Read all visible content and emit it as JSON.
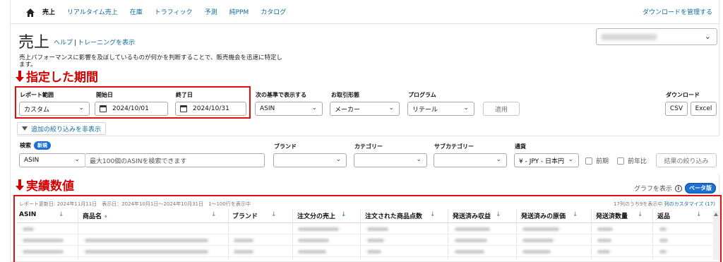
{
  "nav": {
    "items": [
      "売上",
      "リアルタイム売上",
      "在庫",
      "トラフィック",
      "予測",
      "純PPM",
      "カタログ"
    ],
    "active_index": 0,
    "download_manage": "ダウンロードを管理する"
  },
  "header": {
    "title": "売上",
    "help": "ヘルプ",
    "training": "トレーニングを表示",
    "description_line1": "売上パフォーマンスに影響を及ぼしているものが何かを判断することで、販売機会を迅速に特定し",
    "description_line2": "ます。"
  },
  "annotations": {
    "period": "指定した期間",
    "results": "実績数値",
    "color": "#d30000"
  },
  "filters": {
    "report_range_label": "レポート範囲",
    "report_range_value": "カスタム",
    "start_date_label": "開始日",
    "start_date_value": "2024/10/01",
    "end_date_label": "終了日",
    "end_date_value": "2024/10/31",
    "view_by_label": "次の基準で表示する",
    "view_by_value": "ASIN",
    "distributor_label": "お取引形態",
    "distributor_value": "メーカー",
    "program_label": "プログラム",
    "program_value": "リテール",
    "apply": "適用",
    "download_label": "ダウンロード",
    "csv": "CSV",
    "excel": "Excel",
    "hide_filters": "追加の絞り込みを非表示"
  },
  "additional_filters": {
    "search_label": "検索",
    "new_badge": "新規",
    "search_type": "ASIN",
    "search_placeholder": "最大100個のASINを検索できます",
    "brand_label": "ブランド",
    "category_label": "カテゴリー",
    "subcategory_label": "サブカテゴリー",
    "currency_label": "通貨",
    "currency_value": "¥ - JPY - 日本円",
    "prior_period": "前期",
    "prior_year": "前年比",
    "refine": "結果の絞り込み"
  },
  "graph": {
    "show_graph": "グラフを表示",
    "beta": "ベータ版"
  },
  "table": {
    "report_meta": "レポート更新日: 2024年11月11日　表示日：2024年10月1日～2024年10月31日　1～100行を表示中",
    "column_count": "17列のうち9を表示中",
    "customize": "列のカスタマイズ (17)",
    "columns": [
      "ASIN",
      "商品名",
      "ブランド",
      "注文分の売上",
      "注文された商品点数",
      "発送済み収益",
      "発送済みの原価",
      "発送済数量",
      "返品"
    ],
    "sort_glyph": "↓",
    "expand_glyph": "›"
  }
}
